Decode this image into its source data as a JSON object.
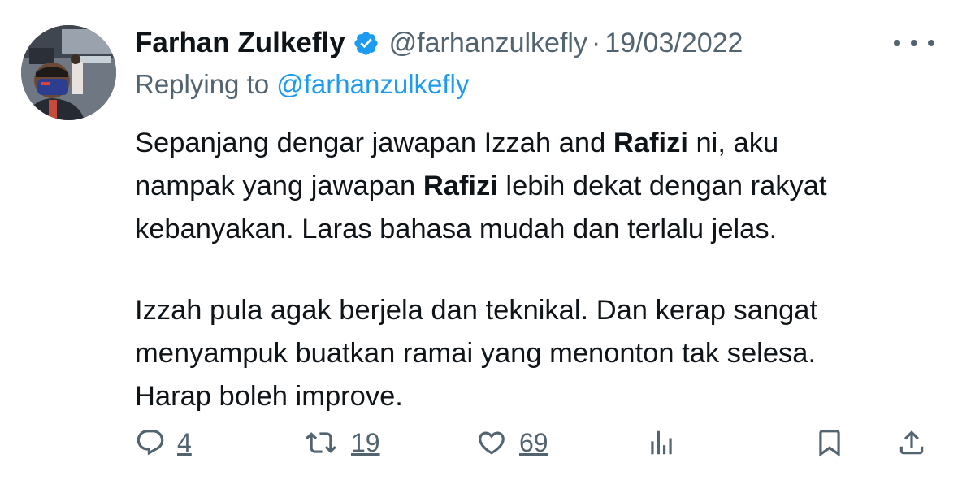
{
  "author": {
    "display_name": "Farhan Zulkefly",
    "handle": "@farhanzulkefly",
    "separator": "·",
    "date": "19/03/2022",
    "verified_icon": "verified-badge-icon",
    "verified_color": "#1d9bf0"
  },
  "reply": {
    "prefix": "Replying to ",
    "mention": "@farhanzulkefly"
  },
  "body": {
    "line1_a": "Sepanjang dengar jawapan Izzah and ",
    "line1_b": "Rafizi",
    "line1_c": " ni, aku",
    "line2_a": "nampak yang jawapan ",
    "line2_b": "Rafizi",
    "line2_c": " lebih dekat dengan rakyat",
    "line3": "kebanyakan. Laras bahasa mudah dan terlalu jelas.",
    "line4": "Izzah pula agak berjela dan teknikal. Dan kerap sangat",
    "line5": "menyampuk buatkan ramai yang menonton tak selesa.",
    "line6": "Harap boleh improve."
  },
  "actions": {
    "replies": {
      "icon": "reply-icon",
      "count": "4"
    },
    "retweets": {
      "icon": "retweet-icon",
      "count": "19"
    },
    "likes": {
      "icon": "heart-icon",
      "count": "69"
    },
    "views": {
      "icon": "views-icon"
    },
    "bookmark": {
      "icon": "bookmark-icon"
    },
    "share": {
      "icon": "share-icon"
    }
  },
  "colors": {
    "text": "#0f1419",
    "secondary": "#536471",
    "accent": "#1d9bf0"
  }
}
